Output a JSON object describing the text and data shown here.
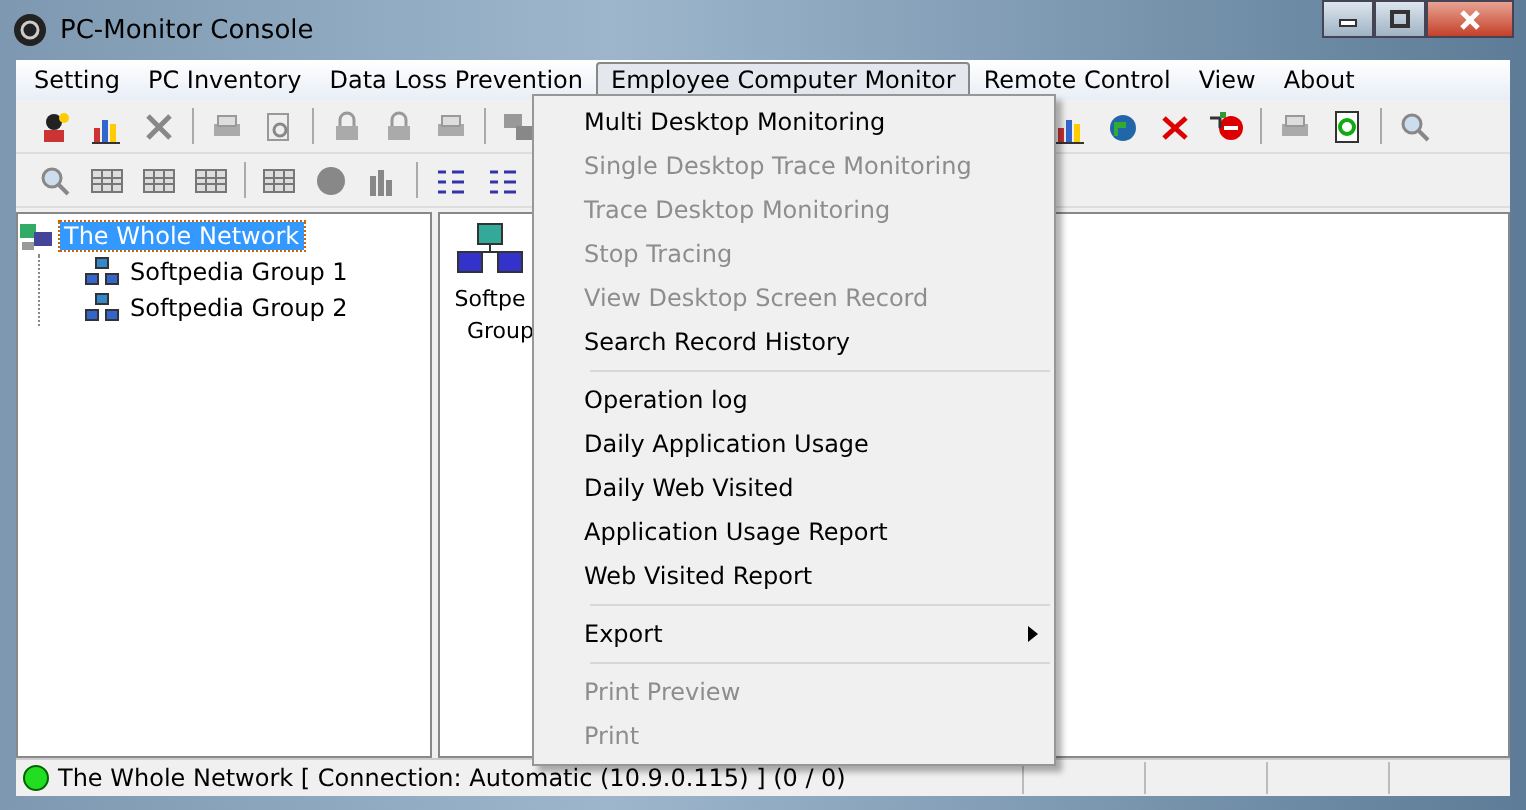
{
  "window": {
    "title": "PC-Monitor Console"
  },
  "menu_bar": [
    {
      "label": "Setting",
      "selected": false
    },
    {
      "label": "PC Inventory",
      "selected": false
    },
    {
      "label": "Data Loss Prevention",
      "selected": false
    },
    {
      "label": "Employee Computer Monitor",
      "selected": true
    },
    {
      "label": "Remote Control",
      "selected": false
    },
    {
      "label": "View",
      "selected": false
    },
    {
      "label": "About",
      "selected": false
    }
  ],
  "dropdown": [
    {
      "kind": "item",
      "label": "Multi Desktop Monitoring",
      "disabled": false
    },
    {
      "kind": "item",
      "label": "Single Desktop Trace Monitoring",
      "disabled": true
    },
    {
      "kind": "item",
      "label": "Trace Desktop Monitoring",
      "disabled": true
    },
    {
      "kind": "item",
      "label": "Stop Tracing",
      "disabled": true
    },
    {
      "kind": "item",
      "label": "View Desktop Screen Record",
      "disabled": true
    },
    {
      "kind": "item",
      "label": "Search Record History",
      "disabled": false
    },
    {
      "kind": "separator"
    },
    {
      "kind": "item",
      "label": "Operation log",
      "disabled": false
    },
    {
      "kind": "item",
      "label": "Daily Application Usage",
      "disabled": false
    },
    {
      "kind": "item",
      "label": "Daily Web Visited",
      "disabled": false
    },
    {
      "kind": "item",
      "label": "Application Usage Report",
      "disabled": false
    },
    {
      "kind": "item",
      "label": "Web Visited Report",
      "disabled": false
    },
    {
      "kind": "separator"
    },
    {
      "kind": "submenu",
      "label": "Export",
      "disabled": false
    },
    {
      "kind": "separator"
    },
    {
      "kind": "item",
      "label": "Print Preview",
      "disabled": true
    },
    {
      "kind": "item",
      "label": "Print",
      "disabled": true
    }
  ],
  "tree": [
    {
      "label": "The Whole Network",
      "selected": true,
      "children": [
        {
          "label": "Softpedia Group 1",
          "selected": false
        },
        {
          "label": "Softpedia Group 2",
          "selected": false
        }
      ]
    }
  ],
  "view_items": [
    {
      "lines": [
        "Softpe",
        "Group"
      ]
    }
  ],
  "status_bar": {
    "connected": true,
    "text": "The Whole Network [ Connection: Automatic (10.9.0.115) ] (0 / 0)"
  }
}
